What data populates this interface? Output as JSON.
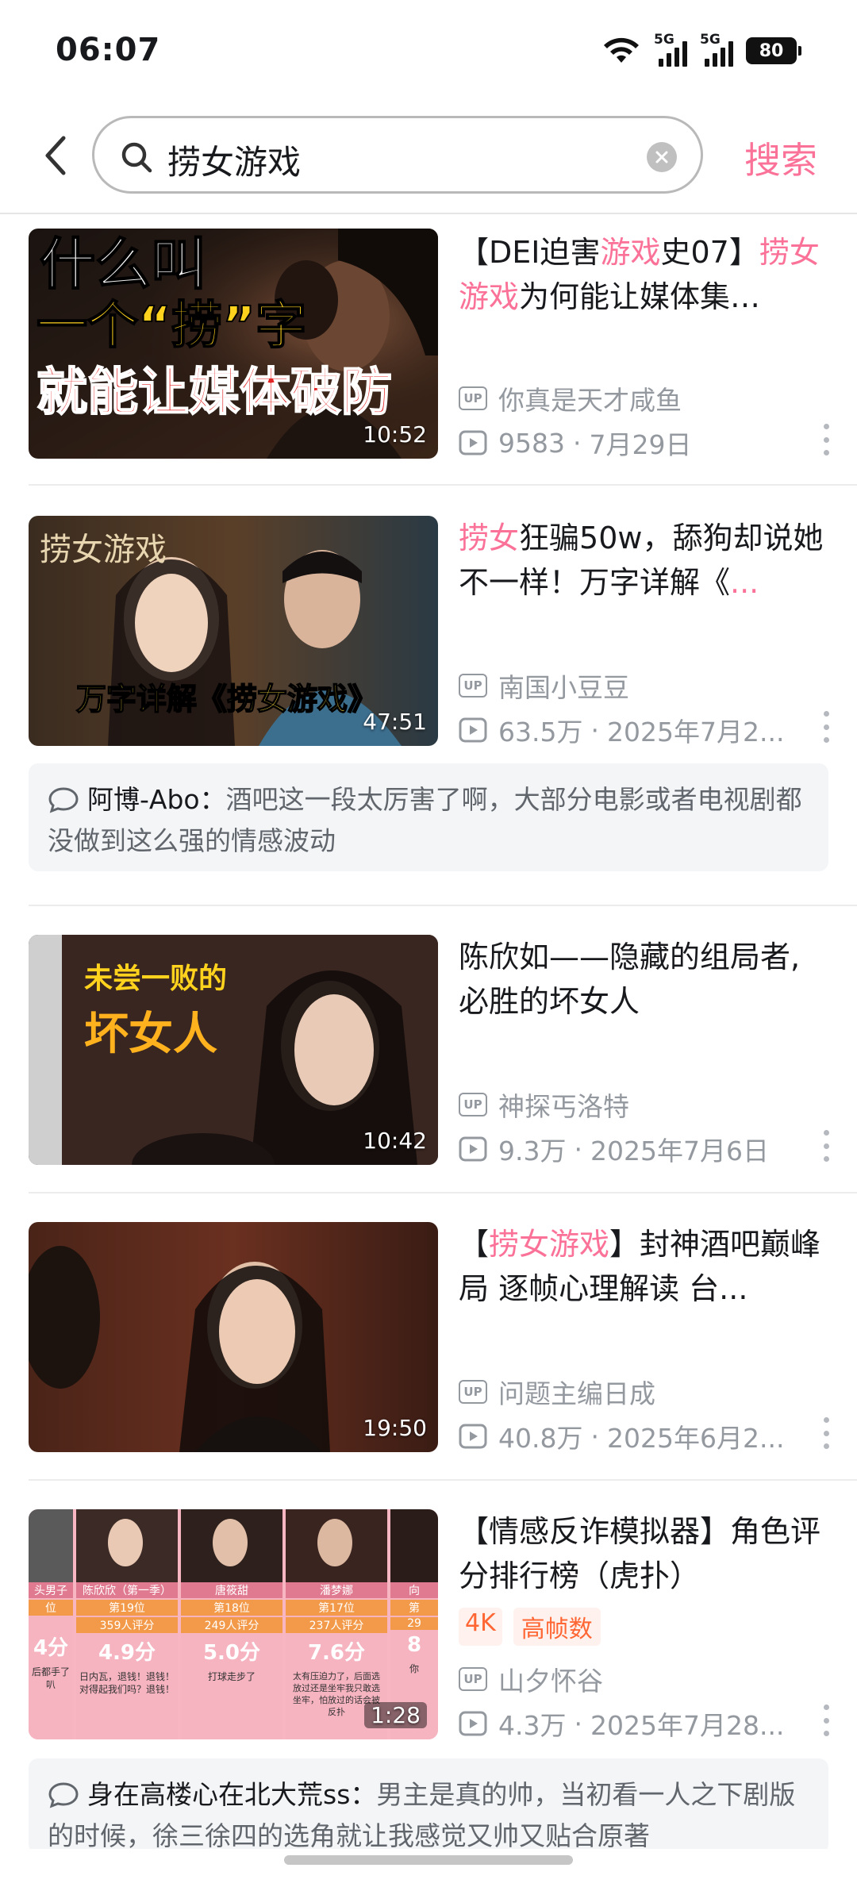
{
  "status_bar": {
    "time": "06:07",
    "network_1": "5G",
    "network_2": "5G",
    "battery": "80"
  },
  "search": {
    "query": "捞女游戏",
    "submit_label": "搜索"
  },
  "colors": {
    "accent_pink": "#fb7299",
    "meta_gray": "#9499a0",
    "tag_orange": "#ff6633"
  },
  "results": [
    {
      "title_parts": [
        "【DEI迫害",
        "游戏",
        "史07】",
        "捞女游戏",
        "为何能让媒体集…"
      ],
      "thumb_text": [
        "什么叫",
        "一个“捞”字",
        "就能让媒体破防"
      ],
      "duration": "10:52",
      "uploader": "你真是天才咸鱼",
      "views": "9583",
      "date": "7月29日"
    },
    {
      "title_parts": [
        "捞女",
        "狂骗50w，舔狗却说她不一样！万字详解《",
        "..."
      ],
      "thumb_text": [
        "捞女游戏",
        "万字详解《捞女游戏》"
      ],
      "duration": "47:51",
      "uploader": "南国小豆豆",
      "views": "63.5万",
      "date": "2025年7月2...",
      "comment_user": "阿博-Abo：",
      "comment_text": "酒吧这一段太厉害了啊，大部分电影或者电视剧都没做到这么强的情感波动"
    },
    {
      "title": "陈欣如——隐藏的组局者,必胜的坏女人",
      "thumb_text": [
        "未尝一败的",
        "坏女人"
      ],
      "duration": "10:42",
      "uploader": "神探丐洛特",
      "views": "9.3万",
      "date": "2025年7月6日"
    },
    {
      "title_parts": [
        "【",
        "捞女游戏",
        "】封神酒吧巅峰局 逐帧心理解读 台..."
      ],
      "duration": "19:50",
      "uploader": "问题主编日成",
      "views": "40.8万",
      "date": "2025年6月2..."
    },
    {
      "title": "【情感反诈模拟器】角色评分排行榜（虎扑）",
      "tags": [
        "4K",
        "高帧数"
      ],
      "duration": "1:28",
      "uploader": "山夕怀谷",
      "views": "4.3万",
      "date": "2025年7月28...",
      "thumb_panels": [
        {
          "name": "头男子",
          "rank": "位",
          "score": "4分",
          "note": "后都手了叭"
        },
        {
          "name": "陈欣欣（第一季）",
          "rank": "第19位",
          "votes": "359人评分",
          "score": "4.9分",
          "note": "日内瓦，退钱！退钱！对得起我们吗？退钱！"
        },
        {
          "name": "唐筱甜",
          "rank": "第18位",
          "votes": "249人评分",
          "score": "5.0分",
          "note": "打球走步了"
        },
        {
          "name": "潘梦娜",
          "rank": "第17位",
          "votes": "237人评分",
          "score": "7.6分",
          "note": "太有压迫力了，后面选放过还是坐牢我只敢选坐牢，怕放过的话会被反扑"
        },
        {
          "name": "向",
          "rank": "第",
          "votes": "29",
          "score": "8",
          "note": "你"
        }
      ],
      "comment_user": "身在高楼心在北大荒ss：",
      "comment_text": "男主是真的帅，当初看一人之下剧版的时候，徐三徐四的选角就让我感觉又帅又贴合原著"
    }
  ]
}
